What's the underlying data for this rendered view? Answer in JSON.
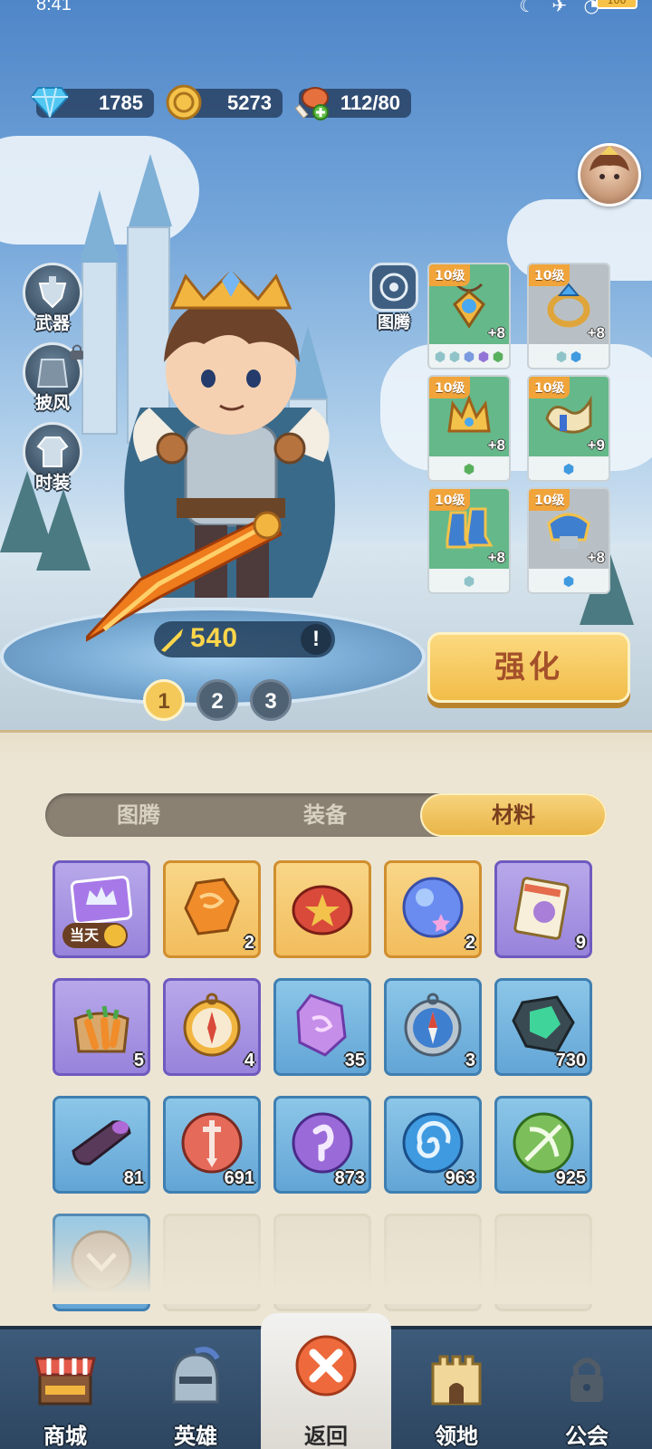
{
  "status": {
    "time": "8:41",
    "battery": "100"
  },
  "currency": {
    "diamond": "1785",
    "coin": "5273",
    "stamina": "112/80"
  },
  "side_menu": [
    {
      "label": "武器",
      "icon": "weapon-icon",
      "locked": false
    },
    {
      "label": "披风",
      "icon": "cloak-icon",
      "locked": true
    },
    {
      "label": "时装",
      "icon": "costume-icon",
      "locked": false
    }
  ],
  "totem_button": {
    "label": "图腾"
  },
  "equipment": [
    {
      "level": "10级",
      "plus": "+8",
      "rarity": "green",
      "icon": "amulet-icon",
      "gems": [
        "#8fc3c8",
        "#8fc3c8",
        "#7a9be0",
        "#9274d6",
        "#58b05c"
      ]
    },
    {
      "level": "10级",
      "plus": "+8",
      "rarity": "gray",
      "icon": "ring-icon",
      "gems": [
        "#8fc3c8",
        "#3f9ae0"
      ]
    },
    {
      "level": "10级",
      "plus": "+8",
      "rarity": "green",
      "icon": "crown-icon",
      "gems": [
        "#58b05c"
      ]
    },
    {
      "level": "10级",
      "plus": "+9",
      "rarity": "green",
      "icon": "horn-icon",
      "gems": [
        "#3f9ae0"
      ]
    },
    {
      "level": "10级",
      "plus": "+8",
      "rarity": "green",
      "icon": "boots-icon",
      "gems": [
        "#8fc3c8"
      ]
    },
    {
      "level": "10级",
      "plus": "+8",
      "rarity": "gray",
      "icon": "shoulder-armor-icon",
      "gems": [
        "#3f9ae0"
      ]
    }
  ],
  "power": {
    "value": "540",
    "info": "!"
  },
  "pages": [
    "1",
    "2",
    "3"
  ],
  "upgrade_button": "强化",
  "tabs": [
    {
      "label": "图腾",
      "active": false
    },
    {
      "label": "装备",
      "active": false
    },
    {
      "label": "材料",
      "active": true
    }
  ],
  "materials": [
    {
      "rarity": "purple",
      "icon": "crown-card-icon",
      "count": "",
      "badge": "当天"
    },
    {
      "rarity": "orange",
      "icon": "amber-ore-icon",
      "count": "2"
    },
    {
      "rarity": "orange",
      "icon": "star-token-icon",
      "count": ""
    },
    {
      "rarity": "orange",
      "icon": "star-orb-icon",
      "count": "2"
    },
    {
      "rarity": "purple",
      "icon": "integral-scroll-icon",
      "count": "9"
    },
    {
      "rarity": "purple",
      "icon": "carrot-sack-icon",
      "count": "5"
    },
    {
      "rarity": "purple",
      "icon": "gold-compass-icon",
      "count": "4"
    },
    {
      "rarity": "blue",
      "icon": "purple-crystal-icon",
      "count": "35"
    },
    {
      "rarity": "blue",
      "icon": "blue-compass-icon",
      "count": "3"
    },
    {
      "rarity": "blue",
      "icon": "green-ore-icon",
      "count": "730"
    },
    {
      "rarity": "blue",
      "icon": "dark-log-icon",
      "count": "81"
    },
    {
      "rarity": "blue",
      "icon": "sword-orb-icon",
      "count": "691"
    },
    {
      "rarity": "blue",
      "icon": "hook-orb-icon",
      "count": "873"
    },
    {
      "rarity": "blue",
      "icon": "swirl-orb-icon",
      "count": "963"
    },
    {
      "rarity": "blue",
      "icon": "bow-orb-icon",
      "count": "925"
    },
    {
      "rarity": "blue",
      "icon": "emblem-orb-icon",
      "count": ""
    },
    {
      "rarity": "empty",
      "icon": "",
      "count": ""
    },
    {
      "rarity": "empty",
      "icon": "",
      "count": ""
    },
    {
      "rarity": "empty",
      "icon": "",
      "count": ""
    },
    {
      "rarity": "empty",
      "icon": "",
      "count": ""
    }
  ],
  "nav": [
    {
      "label": "商城",
      "icon": "shop-icon",
      "active": false
    },
    {
      "label": "英雄",
      "icon": "helmet-icon",
      "active": false
    },
    {
      "label": "返回",
      "icon": "close-icon",
      "active": true
    },
    {
      "label": "领地",
      "icon": "castle-icon",
      "active": false
    },
    {
      "label": "公会",
      "icon": "lock-icon",
      "active": false
    }
  ]
}
